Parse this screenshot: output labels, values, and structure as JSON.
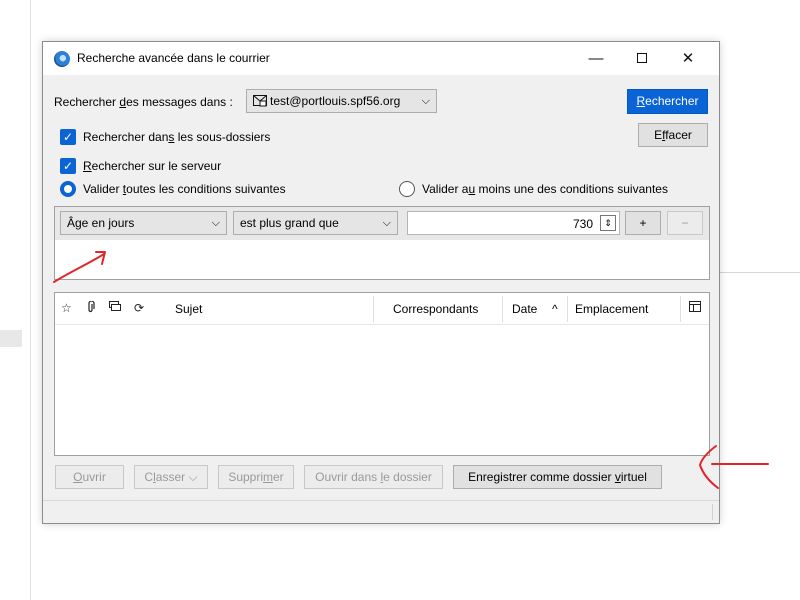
{
  "dialog": {
    "title": "Recherche avancée dans le courrier",
    "min_glyph": "—",
    "close_glyph": "✕"
  },
  "search_in": {
    "label_pre": "Rechercher ",
    "label_u": "d",
    "label_post": "es messages dans :",
    "account_icon": "mail-account-icon",
    "account": "test@portlouis.spf56.org"
  },
  "buttons": {
    "search_pre": "",
    "search_u": "R",
    "search_post": "echercher",
    "clear_pre": "E",
    "clear_u": "f",
    "clear_post": "facer"
  },
  "options": {
    "subfolders_pre": "Rechercher dan",
    "subfolders_u": "s",
    "subfolders_post": " les sous-dossiers",
    "server_pre": "",
    "server_u": "R",
    "server_post": "echercher sur le serveur",
    "match_all_pre": "Valider ",
    "match_all_u": "t",
    "match_all_post": "outes les conditions suivantes",
    "match_any_pre": "Valider a",
    "match_any_u": "u",
    "match_any_post": " moins une des conditions suivantes"
  },
  "condition": {
    "field": "Âge en jours",
    "operator": "est plus grand que",
    "value": "730",
    "add": "+",
    "remove": "−"
  },
  "columns": {
    "subject": "Sujet",
    "correspondents": "Correspondants",
    "date": "Date",
    "sort_indicator": "^",
    "location": "Emplacement"
  },
  "actions": {
    "open_pre": "",
    "open_u": "O",
    "open_post": "uvrir",
    "file_pre": "C",
    "file_u": "l",
    "file_post": "asser",
    "delete_pre": "Suppri",
    "delete_u": "m",
    "delete_post": "er",
    "open_folder_pre": "Ouvrir dans ",
    "open_folder_u": "l",
    "open_folder_post": "e dossier",
    "save_virtual_pre": "Enregistrer comme dossier ",
    "save_virtual_u": "v",
    "save_virtual_post": "irtuel"
  },
  "colors": {
    "accent": "#0a64d6",
    "annotation": "#e0262a"
  }
}
